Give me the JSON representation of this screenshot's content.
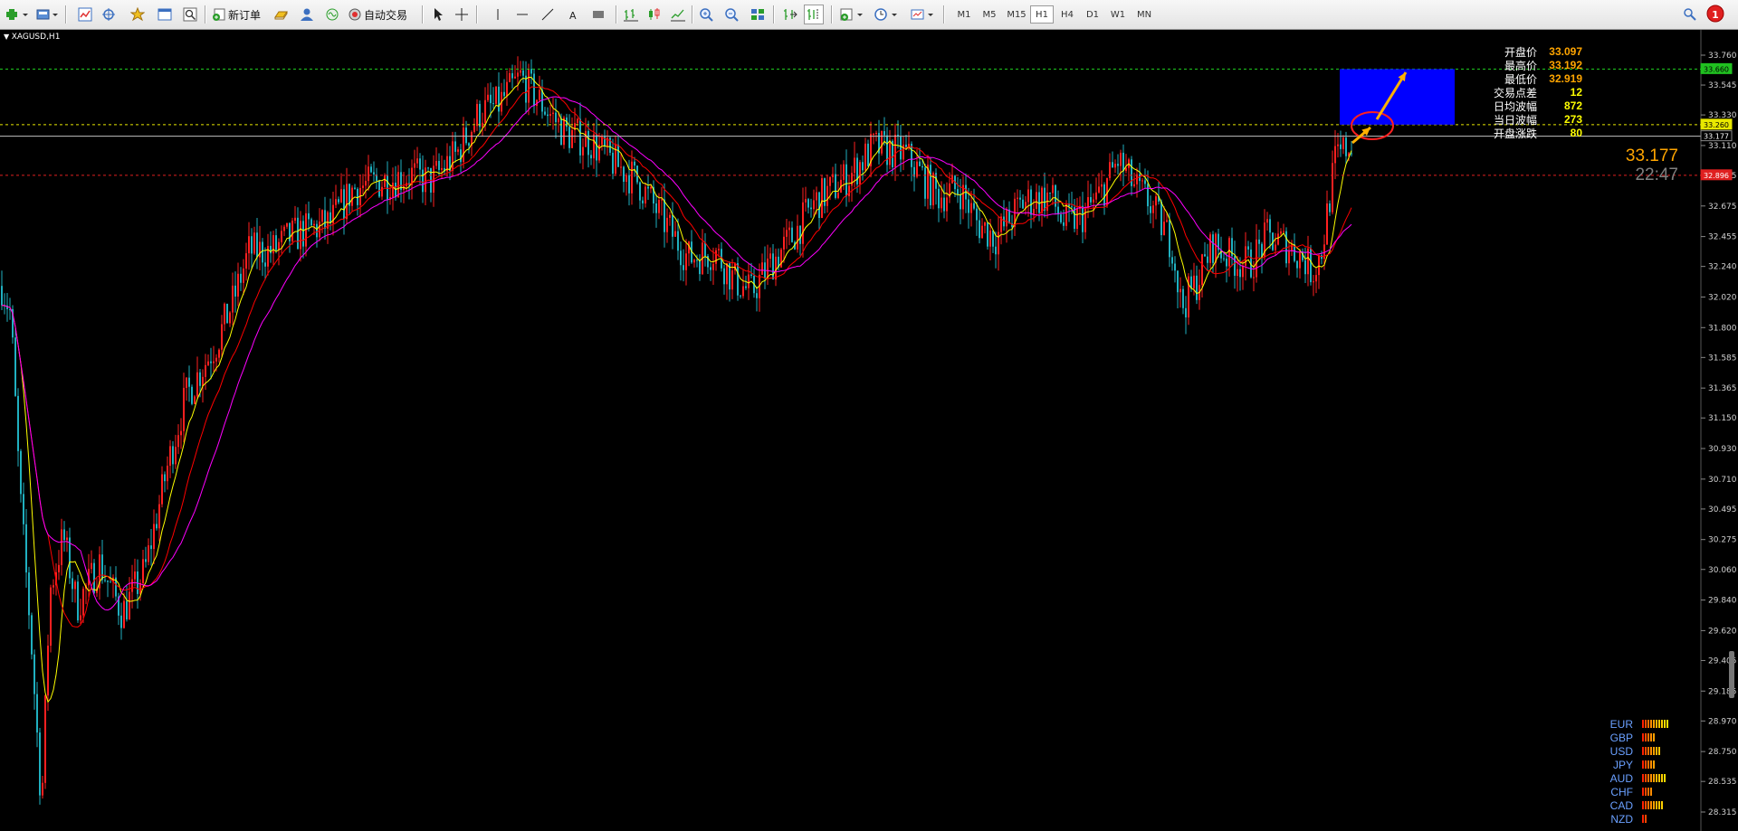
{
  "toolbar": {
    "new_order_label": "新订单",
    "auto_trade_label": "自动交易",
    "timeframes": [
      "M1",
      "M5",
      "M15",
      "H1",
      "H4",
      "D1",
      "W1",
      "MN"
    ],
    "active_timeframe": "H1",
    "alert_count": "1"
  },
  "chart": {
    "title": "XAGUSD,H1",
    "current_price": "33.177",
    "countdown": "22:47",
    "colors": {
      "background": "#000000",
      "bull_candle": "#ff2020",
      "bear_candle": "#20b0c0",
      "ma_fast": "#ffff00",
      "ma_mid": "#ff0000",
      "ma_slow": "#ff00ff",
      "target_box": "#0000ff",
      "arrow": "#ffb000"
    },
    "price_axis": [
      "33.760",
      "33.545",
      "33.330",
      "33.110",
      "32.895",
      "32.675",
      "32.455",
      "32.240",
      "32.020",
      "31.800",
      "31.585",
      "31.365",
      "31.150",
      "30.930",
      "30.710",
      "30.495",
      "30.275",
      "30.060",
      "29.840",
      "29.620",
      "29.405",
      "29.185",
      "28.970",
      "28.750",
      "28.535",
      "28.315"
    ],
    "price_tags": {
      "upper_green": "33.660",
      "yellow": "33.260",
      "current": "33.177",
      "red": "32.896"
    }
  },
  "stats": [
    {
      "label": "开盘价",
      "value": "33.097",
      "color": "#ffa500"
    },
    {
      "label": "最高价",
      "value": "33.192",
      "color": "#ffa500"
    },
    {
      "label": "最低价",
      "value": "32.919",
      "color": "#ffa500"
    },
    {
      "label": "交易点差",
      "value": "12",
      "color": "#ffff00"
    },
    {
      "label": "日均波幅",
      "value": "872",
      "color": "#ffff00"
    },
    {
      "label": "当日波幅",
      "value": "273",
      "color": "#ffff00"
    },
    {
      "label": "开盘涨跌",
      "value": "80",
      "color": "#ffff00"
    }
  ],
  "currency_strength": [
    {
      "currency": "EUR",
      "level": 10
    },
    {
      "currency": "GBP",
      "level": 5
    },
    {
      "currency": "USD",
      "level": 7
    },
    {
      "currency": "JPY",
      "level": 5
    },
    {
      "currency": "AUD",
      "level": 9
    },
    {
      "currency": "CHF",
      "level": 4
    },
    {
      "currency": "CAD",
      "level": 8
    },
    {
      "currency": "NZD",
      "level": 2
    }
  ]
}
